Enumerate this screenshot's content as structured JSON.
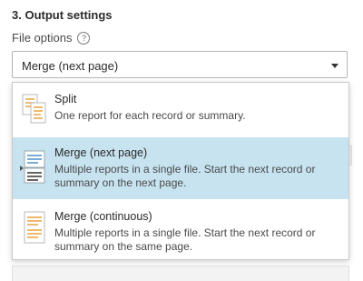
{
  "section": {
    "title": "3. Output settings"
  },
  "file_options": {
    "label": "File options",
    "help_glyph": "?",
    "selected_value": "Merge (next page)"
  },
  "dropdown": {
    "options": [
      {
        "title": "Split",
        "description": "One report for each record or summary.",
        "icon": "split-document-icon",
        "selected": false
      },
      {
        "title": "Merge (next page)",
        "description": "Multiple reports in a single file. Start the next record or summary on the next page.",
        "icon": "merge-next-page-icon",
        "selected": true
      },
      {
        "title": "Merge (continuous)",
        "description": "Multiple reports in a single file. Start the next record or summary on the same page.",
        "icon": "merge-continuous-icon",
        "selected": false
      }
    ]
  },
  "colors": {
    "selected_background": "#c7e3f0",
    "accent_orange": "#e8a33d",
    "accent_blue": "#4a8fc7"
  }
}
